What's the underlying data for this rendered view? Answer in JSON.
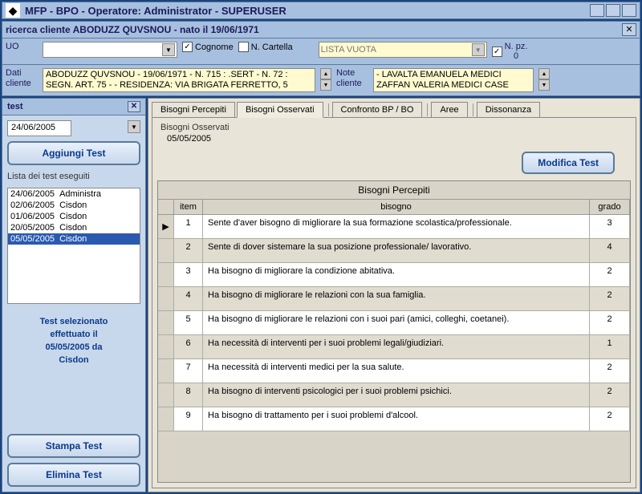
{
  "window": {
    "title": "MFP  - BPO  - Operatore: Administrator -  SUPERUSER"
  },
  "search": {
    "barTitle": "ricerca cliente  ABODUZZ QUVSNOU  - nato il 19/06/1971",
    "uoLabel": "UO",
    "cognomeLabel": "Cognome",
    "cartellaLabel": "N. Cartella",
    "listaVuota": "LISTA VUOTA",
    "npzLabel": "N. pz.",
    "npzValue": "0",
    "datiClienteLabel1": "Dati",
    "datiClienteLabel2": "cliente",
    "datiLine1": "ABODUZZ QUVSNOU - 19/06/1971 - N. 715 : .SERT - N. 72 :",
    "datiLine2": "SEGN. ART. 75 -  - RESIDENZA: VIA BRIGATA FERRETTO, 5",
    "noteLabel1": "Note",
    "noteLabel2": "cliente",
    "noteLine1": "- LAVALTA EMANUELA MEDICI",
    "noteLine2": "ZAFFAN VALERIA MEDICI CASE"
  },
  "sidebar": {
    "title": "test",
    "date": "24/06/2005",
    "addBtn": "Aggiungi Test",
    "listLabel": "Lista dei test eseguiti",
    "tests": [
      {
        "date": "24/06/2005",
        "op": "Administra"
      },
      {
        "date": "02/06/2005",
        "op": "Cisdon"
      },
      {
        "date": "01/06/2005",
        "op": "Cisdon"
      },
      {
        "date": "20/05/2005",
        "op": "Cisdon"
      },
      {
        "date": "05/05/2005",
        "op": "Cisdon"
      }
    ],
    "selectedText1": "Test selezionato",
    "selectedText2": "effettuato il",
    "selectedText3": "05/05/2005 da",
    "selectedText4": "Cisdon",
    "printBtn": "Stampa Test",
    "deleteBtn": "Elimina Test"
  },
  "tabs": {
    "t1": "Bisogni Percepiti",
    "t2": "Bisogni Osservati",
    "t3": "Confronto BP / BO",
    "t4": "Aree",
    "t5": "Dissonanza"
  },
  "panel": {
    "fieldsetTitle": "Bisogni Osservati",
    "fieldsetDate": "05/05/2005",
    "modifyBtn": "Modifica Test",
    "tableTitle": "Bisogni Percepiti",
    "colItem": "item",
    "colBisogno": "bisogno",
    "colGrado": "grado",
    "rows": [
      {
        "n": "1",
        "txt": "Sente d'aver bisogno di migliorare la sua formazione scolastica/professionale.",
        "g": "3"
      },
      {
        "n": "2",
        "txt": "Sente di dover sistemare la sua posizione professionale/ lavorativo.",
        "g": "4"
      },
      {
        "n": "3",
        "txt": "Ha bisogno di migliorare la condizione abitativa.",
        "g": "2"
      },
      {
        "n": "4",
        "txt": "Ha bisogno di migliorare le relazioni con la sua famiglia.",
        "g": "2"
      },
      {
        "n": "5",
        "txt": "Ha bisogno di migliorare le relazioni con i suoi pari (amici, colleghi, coetanei).",
        "g": "2"
      },
      {
        "n": "6",
        "txt": "Ha necessità di interventi per i suoi problemi legali/giudiziari.",
        "g": "1"
      },
      {
        "n": "7",
        "txt": "Ha necessità di interventi medici per la sua salute.",
        "g": "2"
      },
      {
        "n": "8",
        "txt": "Ha bisogno di interventi psicologici per i suoi problemi psichici.",
        "g": "2"
      },
      {
        "n": "9",
        "txt": "Ha bisogno di trattamento per i suoi problemi d'alcool.",
        "g": "2"
      }
    ]
  }
}
